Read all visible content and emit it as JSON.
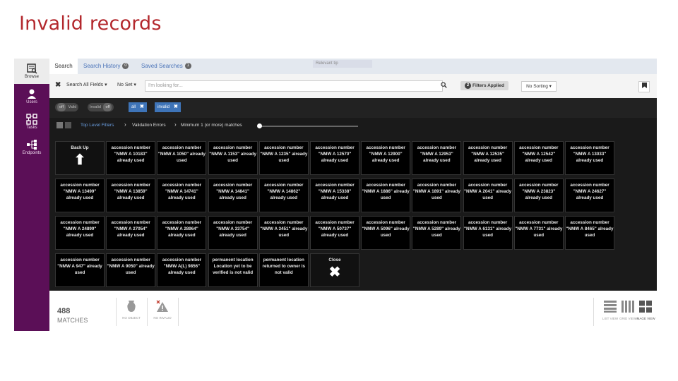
{
  "slide": {
    "title": "Invalid records"
  },
  "sidebar": {
    "items": [
      {
        "label": "Browse",
        "icon": "browse-icon",
        "active": true
      },
      {
        "label": "Users",
        "icon": "users-icon"
      },
      {
        "label": "Tasks",
        "icon": "tasks-icon"
      },
      {
        "label": "Endpoints",
        "icon": "endpoints-icon"
      }
    ]
  },
  "tabs": {
    "search": "Search",
    "history": "Search History",
    "history_count": "0",
    "saved": "Saved Searches",
    "saved_count": "1",
    "tip": "Relevant tip"
  },
  "searchbar": {
    "clear": "✖",
    "field_select": "Search All Fields ▾",
    "set_select": "No Set ▾",
    "placeholder": "I'm looking for...",
    "filters_count": "2",
    "filters_label": "Filters Applied",
    "sort_label": "No Sorting ▾"
  },
  "filterbar": {
    "valid_toggle": {
      "state": "off",
      "label": "Valid"
    },
    "invalid_toggle": {
      "label": "Invalid",
      "state": "off"
    },
    "chips": [
      {
        "label": "all",
        "remove": "✖"
      },
      {
        "label": "invalid",
        "remove": "✖"
      }
    ]
  },
  "crumbs": {
    "top_level": "Top Level Filters",
    "sep1": "›",
    "validation": "Validation Errors",
    "sep2": "›",
    "minimum": "Minimum 1 (or more) matches"
  },
  "tiles": [
    {
      "type": "nav",
      "label": "Back Up",
      "glyph": "⬆"
    },
    {
      "label": "accession number \"NMW A 10183\" already used"
    },
    {
      "label": "accession number \"NMW A 1050\" already used"
    },
    {
      "label": "accession number \"NMW A 1153\" already used"
    },
    {
      "label": "accession number \"NMW A 1235\" already used"
    },
    {
      "label": "accession number \"NMW A 12570\" already used"
    },
    {
      "label": "accession number \"NMW A 12900\" already used"
    },
    {
      "label": "accession number \"NMW A 12953\" already used"
    },
    {
      "label": "accession number \"NMW A 12535\" already used"
    },
    {
      "label": "accession number \"NMW A 12542\" already used"
    },
    {
      "label": "accession number \"NMW A 13033\" already used"
    },
    {
      "label": "accession number \"NMW A 13499\" already used"
    },
    {
      "label": "accession number \"NMW A 13859\" already used"
    },
    {
      "label": "accession number \"NMW A 14741\" already used"
    },
    {
      "label": "accession number \"NMW A 14841\" already used"
    },
    {
      "label": "accession number \"NMW A 14862\" already used"
    },
    {
      "label": "accession number \"NMW A 15338\" already used"
    },
    {
      "label": "accession number \"NMW A 1886\" already used"
    },
    {
      "label": "accession number \"NMW A 1891\" already used"
    },
    {
      "label": "accession number \"NMW A 2041\" already used"
    },
    {
      "label": "accession number \"NMW A 23823\" already used"
    },
    {
      "label": "accession number \"NMW A 24627\" already used"
    },
    {
      "label": "accession number \"NMW A 24899\" already used"
    },
    {
      "label": "accession number \"NMW A 27054\" already used"
    },
    {
      "label": "accession number \"NMW A 28964\" already used"
    },
    {
      "label": "accession number \"NMW A 33754\" already used"
    },
    {
      "label": "accession number \"NMW A 3451\" already used"
    },
    {
      "label": "accession number \"NMW A 50737\" already used"
    },
    {
      "label": "accession number \"NMW A 5096\" already used"
    },
    {
      "label": "accession number \"NMW A 5289\" already used"
    },
    {
      "label": "accession number \"NMW A 6131\" already used"
    },
    {
      "label": "accession number \"NMW A 7731\" already used"
    },
    {
      "label": "accession number \"NMW A 8465\" already used"
    },
    {
      "label": "accession number \"NMW A 947\" already used"
    },
    {
      "label": "accession number \"NMW A 9050\" already used"
    },
    {
      "label": "accession number \"NMW A(L) 9856\" already used"
    },
    {
      "label": "permanent location Location yet to be verified is not valid"
    },
    {
      "label": "permanent location returned to owner is not valid"
    },
    {
      "type": "nav",
      "label": "Close",
      "glyph": "✖"
    }
  ],
  "bottom": {
    "count": "488",
    "count_label": "MATCHES",
    "filters": [
      {
        "icon": "object-icon",
        "label": "NO OBJECT"
      },
      {
        "icon": "warning-icon",
        "label": "NO INVALID"
      }
    ],
    "views": [
      {
        "icon": "list-view-icon",
        "label": "LIST VIEW"
      },
      {
        "icon": "grid-view-icon",
        "label": "GRID VIEW"
      },
      {
        "icon": "image-view-icon",
        "label": "IMAGE VIEW"
      }
    ]
  }
}
